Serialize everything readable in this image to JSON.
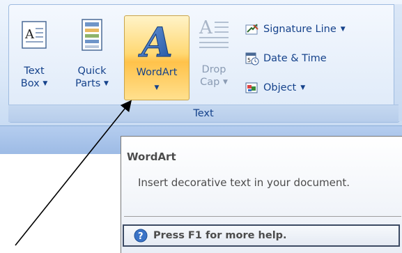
{
  "ribbon": {
    "group_label": "Text",
    "text_box": {
      "line1": "Text",
      "line2": "Box"
    },
    "quick_parts": {
      "line1": "Quick",
      "line2": "Parts"
    },
    "wordart": {
      "line1": "WordArt"
    },
    "drop_cap": {
      "line1": "Drop",
      "line2": "Cap"
    },
    "signature_line": "Signature Line",
    "date_time": "Date & Time",
    "object": "Object",
    "dropdown_glyph": "▼"
  },
  "tooltip": {
    "title": "WordArt",
    "description": "Insert decorative text in your document.",
    "help": "Press F1 for more help."
  },
  "colors": {
    "ribbon_text": "#15428b",
    "highlight": "#ffd873",
    "tooltip_text": "#4c4c4c"
  }
}
